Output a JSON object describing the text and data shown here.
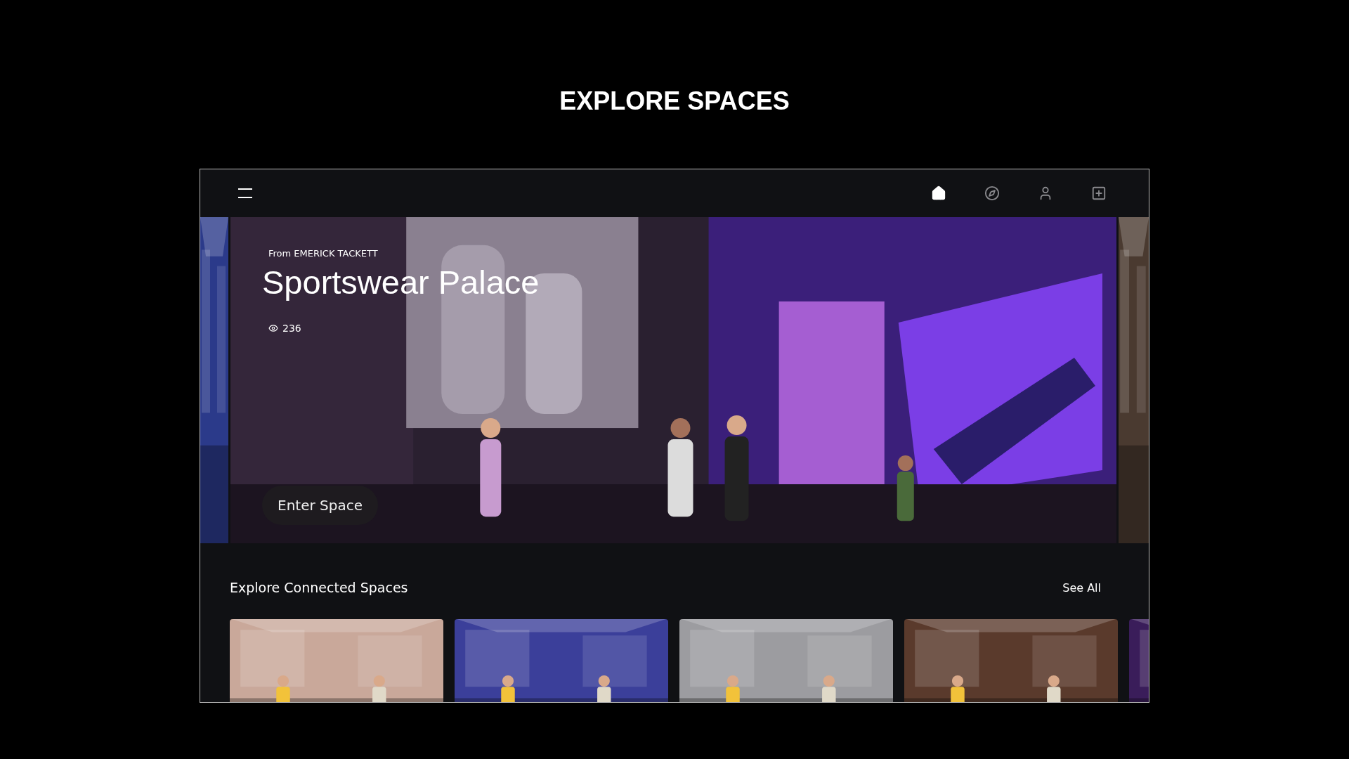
{
  "heading": "EXPLORE SPACES",
  "nav": {
    "menu": {
      "kind": "menu"
    },
    "items": [
      {
        "kind": "home",
        "selected": true
      },
      {
        "kind": "compass",
        "selected": false
      },
      {
        "kind": "user",
        "selected": false
      },
      {
        "kind": "add",
        "selected": false
      }
    ]
  },
  "hero": {
    "from": "From EMERICK TACKETT",
    "title": "Sportswear Palace",
    "views": "236",
    "button": "Enter Space"
  },
  "section": {
    "title": "Explore Connected Spaces",
    "see_all": "See All"
  }
}
